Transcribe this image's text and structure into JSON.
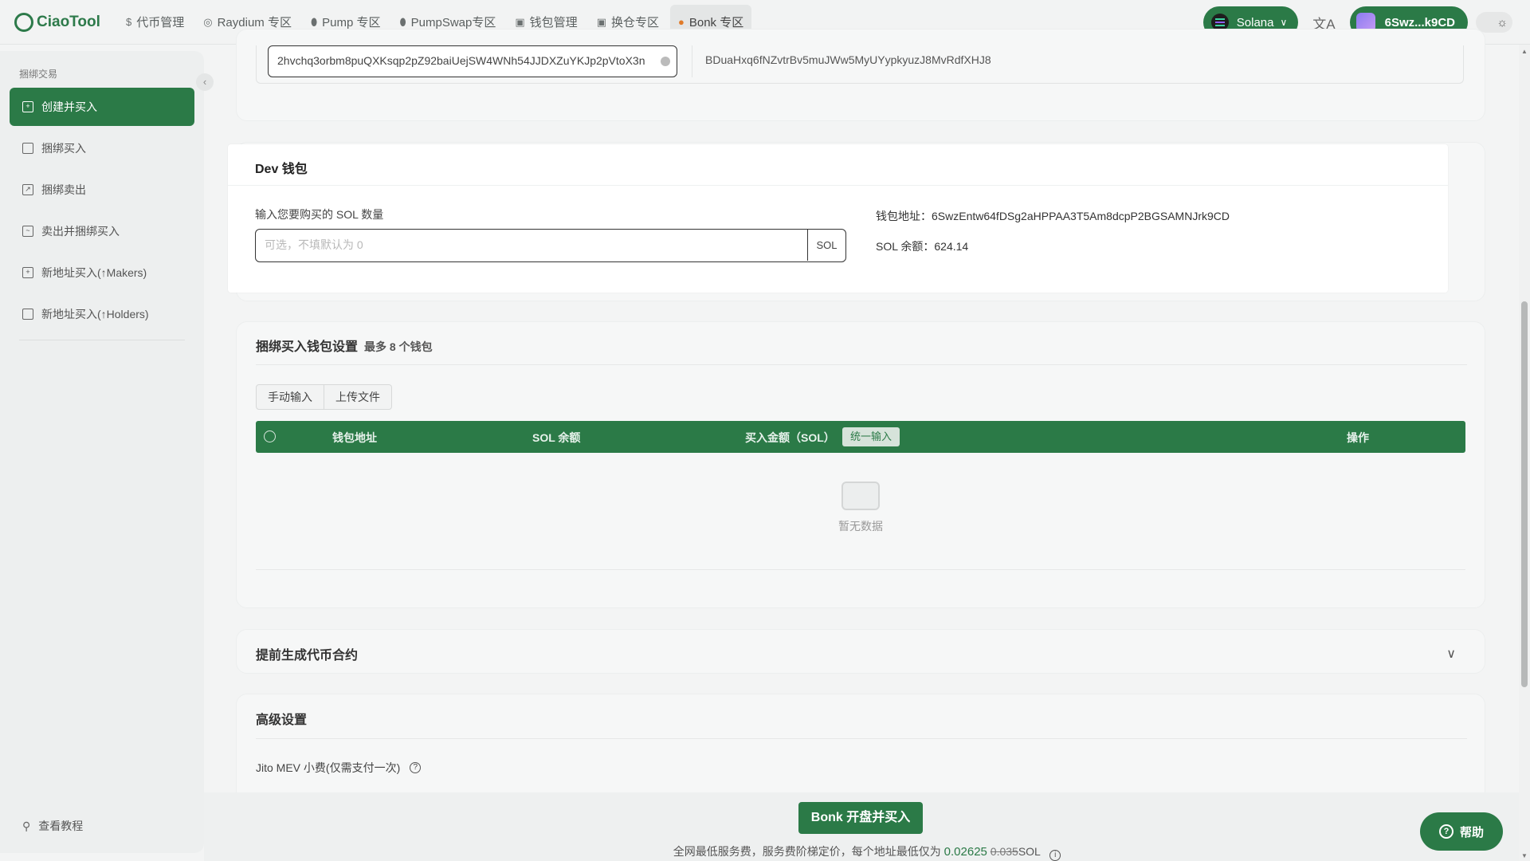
{
  "app": {
    "logo_text": "CiaoTool"
  },
  "nav": {
    "items": [
      {
        "label": "代币管理",
        "icon": "coin-icon"
      },
      {
        "label": "Raydium 专区",
        "icon": "raydium-icon"
      },
      {
        "label": "Pump 专区",
        "icon": "pill-icon"
      },
      {
        "label": "PumpSwap专区",
        "icon": "pill-icon"
      },
      {
        "label": "钱包管理",
        "icon": "wallet-icon"
      },
      {
        "label": "换仓专区",
        "icon": "swap-icon"
      },
      {
        "label": "Bonk 专区",
        "icon": "bonk-icon"
      }
    ],
    "active": "Bonk 专区"
  },
  "topright": {
    "chain_label": "Solana",
    "lang_icon": "translate-icon",
    "wallet_label": "6Swz...k9CD",
    "theme_icon": "sun-icon"
  },
  "sidebar": {
    "group_label": "捆绑交易",
    "items": [
      {
        "label": "创建并买入",
        "active": true
      },
      {
        "label": "捆绑买入"
      },
      {
        "label": "捆绑卖出"
      },
      {
        "label": "卖出并捆绑买入"
      },
      {
        "label": "新地址买入(↑Makers)"
      },
      {
        "label": "新地址买入(↑Holders)"
      }
    ],
    "tutorial_label": "查看教程"
  },
  "token_addr": {
    "input_value": "2hvchq3orbm8puQXKsqp2pZ92baiUejSW4WNh54JJDXZuYKJp2pVtoX3n",
    "other_value": "BDuaHxq6fNZvtrBv5muJWw5MyUYypkyuzJ8MvRdfXHJ8"
  },
  "dev_wallet": {
    "title": "Dev 钱包",
    "input_label": "输入您要购买的 SOL 数量",
    "input_placeholder": "可选，不填默认为 0",
    "input_suffix": "SOL",
    "address_line": "钱包地址：6SwzEntw64fDSg2aHPPAA3T5Am8dcpP2BGSAMNJrk9CD",
    "balance_line": "SOL 余额：624.14"
  },
  "bundle": {
    "title": "捆绑买入钱包设置",
    "subtitle": "最多 8 个钱包",
    "tabs": [
      "手动输入",
      "上传文件"
    ],
    "columns": [
      "钱包地址",
      "SOL 余额",
      "买入金额（SOL）",
      "操作"
    ],
    "unify_label": "统一输入",
    "empty_text": "暂无数据"
  },
  "pregen": {
    "title": "提前生成代币合约"
  },
  "advanced": {
    "title": "高级设置",
    "jito_label": "Jito MEV 小费(仅需支付一次)"
  },
  "footer": {
    "cta_label": "Bonk 开盘并买入",
    "fee_prefix": "全网最低服务费，服务费阶梯定价，每个地址最低仅为",
    "fee_new": "0.02625",
    "fee_old": "0.035",
    "fee_unit": "SOL",
    "help_label": "帮助"
  }
}
